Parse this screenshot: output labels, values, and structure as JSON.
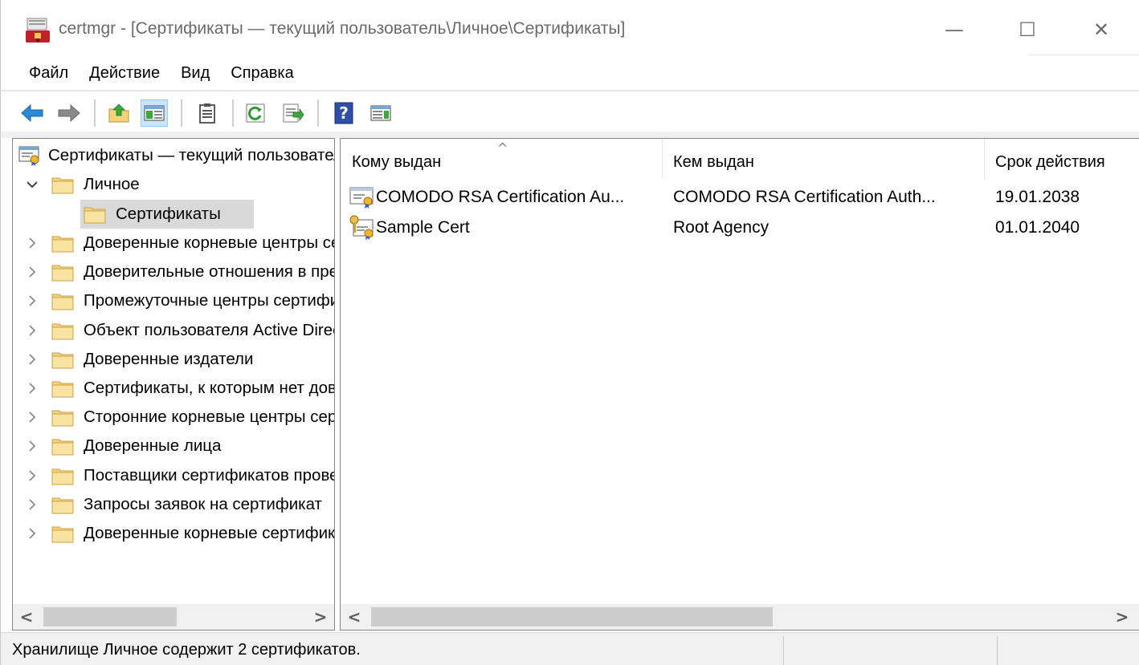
{
  "window": {
    "title": "certmgr - [Сертификаты — текущий пользователь\\Личное\\Сертификаты]",
    "minimize_glyph": "—",
    "maximize_glyph": "☐",
    "close_glyph": "✕"
  },
  "menu": [
    "Файл",
    "Действие",
    "Вид",
    "Справка"
  ],
  "toolbar": {
    "icons": [
      "back-arrow-icon",
      "forward-arrow-icon",
      "up-folder-icon",
      "show-hide-console-tree-icon",
      "properties-icon",
      "refresh-icon",
      "export-list-icon",
      "help-icon",
      "show-hide-action-pane-icon"
    ]
  },
  "tree": {
    "root": "Сертификаты — текущий пользователь",
    "personal": "Личное",
    "personal_certs": "Сертификаты",
    "items": [
      "Доверенные корневые центры сертификации",
      "Доверительные отношения в предприятии",
      "Промежуточные центры сертификации",
      "Объект пользователя Active Directory",
      "Доверенные издатели",
      "Сертификаты, к которым нет доверия",
      "Сторонние корневые центры сертификации",
      "Доверенные лица",
      "Поставщики сертификатов проверки подлинности клиентов",
      "Запросы заявок на сертификат",
      "Доверенные корневые сертификаты смарт-карты"
    ]
  },
  "list": {
    "columns": [
      "Кому выдан",
      "Кем выдан",
      "Срок действия"
    ],
    "rows": [
      {
        "issued_to": "COMODO RSA Certification Au...",
        "issued_by": "COMODO RSA Certification Auth...",
        "expires": "19.01.2038",
        "icon": "certificate-icon"
      },
      {
        "issued_to": "Sample Cert",
        "issued_by": "Root Agency",
        "expires": "01.01.2040",
        "icon": "certificate-key-icon"
      }
    ]
  },
  "scroll": {
    "left": "<",
    "right": ">"
  },
  "status": "Хранилище Личное содержит 2 сертификатов.",
  "colors": {
    "folder": "#f4d27a",
    "selection": "#d9d9d9",
    "toolbar_pressed": "#cce4f7"
  }
}
